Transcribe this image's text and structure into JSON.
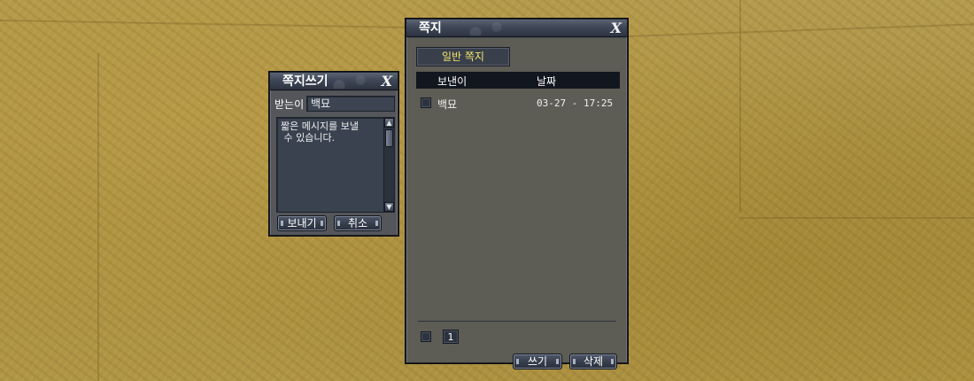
{
  "compose_window": {
    "title": "쪽지쓰기",
    "close_label": "X",
    "recipient_label": "받는이",
    "recipient_value": "백묘",
    "message_line_1": "짧은 메시지를 보낼",
    "message_line_2": " 수 있습니다.",
    "send_button": "보내기",
    "cancel_button": "취소"
  },
  "inbox_window": {
    "title": "쪽지",
    "close_label": "X",
    "tab_label": "일반 쪽지",
    "columns": [
      "보낸이",
      "날짜"
    ],
    "messages": [
      {
        "sender": "백묘",
        "date": "03-27 - 17:25"
      }
    ],
    "page_number": "1",
    "write_button": "쓰기",
    "delete_button": "삭제"
  },
  "colors": {
    "tab_text": "#f2e36a",
    "header_bg": "#12161f",
    "panel_bg": "#5c5c56"
  }
}
